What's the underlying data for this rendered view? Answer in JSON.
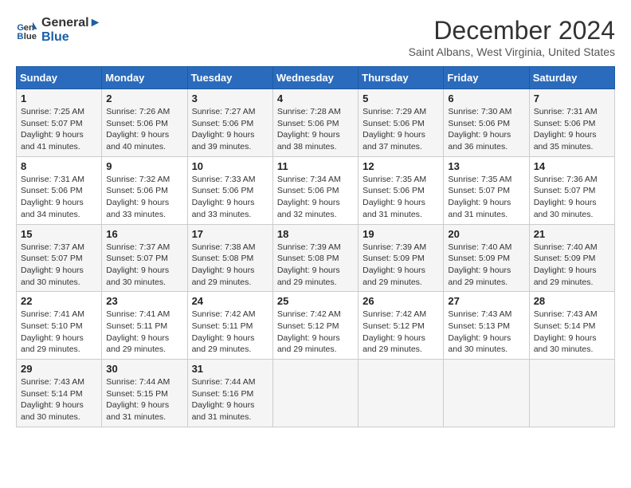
{
  "logo": {
    "line1": "General",
    "line2": "Blue"
  },
  "title": "December 2024",
  "subtitle": "Saint Albans, West Virginia, United States",
  "weekdays": [
    "Sunday",
    "Monday",
    "Tuesday",
    "Wednesday",
    "Thursday",
    "Friday",
    "Saturday"
  ],
  "weeks": [
    [
      {
        "day": "1",
        "sunrise": "7:25 AM",
        "sunset": "5:07 PM",
        "daylight": "9 hours and 41 minutes."
      },
      {
        "day": "2",
        "sunrise": "7:26 AM",
        "sunset": "5:06 PM",
        "daylight": "9 hours and 40 minutes."
      },
      {
        "day": "3",
        "sunrise": "7:27 AM",
        "sunset": "5:06 PM",
        "daylight": "9 hours and 39 minutes."
      },
      {
        "day": "4",
        "sunrise": "7:28 AM",
        "sunset": "5:06 PM",
        "daylight": "9 hours and 38 minutes."
      },
      {
        "day": "5",
        "sunrise": "7:29 AM",
        "sunset": "5:06 PM",
        "daylight": "9 hours and 37 minutes."
      },
      {
        "day": "6",
        "sunrise": "7:30 AM",
        "sunset": "5:06 PM",
        "daylight": "9 hours and 36 minutes."
      },
      {
        "day": "7",
        "sunrise": "7:31 AM",
        "sunset": "5:06 PM",
        "daylight": "9 hours and 35 minutes."
      }
    ],
    [
      {
        "day": "8",
        "sunrise": "7:31 AM",
        "sunset": "5:06 PM",
        "daylight": "9 hours and 34 minutes."
      },
      {
        "day": "9",
        "sunrise": "7:32 AM",
        "sunset": "5:06 PM",
        "daylight": "9 hours and 33 minutes."
      },
      {
        "day": "10",
        "sunrise": "7:33 AM",
        "sunset": "5:06 PM",
        "daylight": "9 hours and 33 minutes."
      },
      {
        "day": "11",
        "sunrise": "7:34 AM",
        "sunset": "5:06 PM",
        "daylight": "9 hours and 32 minutes."
      },
      {
        "day": "12",
        "sunrise": "7:35 AM",
        "sunset": "5:06 PM",
        "daylight": "9 hours and 31 minutes."
      },
      {
        "day": "13",
        "sunrise": "7:35 AM",
        "sunset": "5:07 PM",
        "daylight": "9 hours and 31 minutes."
      },
      {
        "day": "14",
        "sunrise": "7:36 AM",
        "sunset": "5:07 PM",
        "daylight": "9 hours and 30 minutes."
      }
    ],
    [
      {
        "day": "15",
        "sunrise": "7:37 AM",
        "sunset": "5:07 PM",
        "daylight": "9 hours and 30 minutes."
      },
      {
        "day": "16",
        "sunrise": "7:37 AM",
        "sunset": "5:07 PM",
        "daylight": "9 hours and 30 minutes."
      },
      {
        "day": "17",
        "sunrise": "7:38 AM",
        "sunset": "5:08 PM",
        "daylight": "9 hours and 29 minutes."
      },
      {
        "day": "18",
        "sunrise": "7:39 AM",
        "sunset": "5:08 PM",
        "daylight": "9 hours and 29 minutes."
      },
      {
        "day": "19",
        "sunrise": "7:39 AM",
        "sunset": "5:09 PM",
        "daylight": "9 hours and 29 minutes."
      },
      {
        "day": "20",
        "sunrise": "7:40 AM",
        "sunset": "5:09 PM",
        "daylight": "9 hours and 29 minutes."
      },
      {
        "day": "21",
        "sunrise": "7:40 AM",
        "sunset": "5:09 PM",
        "daylight": "9 hours and 29 minutes."
      }
    ],
    [
      {
        "day": "22",
        "sunrise": "7:41 AM",
        "sunset": "5:10 PM",
        "daylight": "9 hours and 29 minutes."
      },
      {
        "day": "23",
        "sunrise": "7:41 AM",
        "sunset": "5:11 PM",
        "daylight": "9 hours and 29 minutes."
      },
      {
        "day": "24",
        "sunrise": "7:42 AM",
        "sunset": "5:11 PM",
        "daylight": "9 hours and 29 minutes."
      },
      {
        "day": "25",
        "sunrise": "7:42 AM",
        "sunset": "5:12 PM",
        "daylight": "9 hours and 29 minutes."
      },
      {
        "day": "26",
        "sunrise": "7:42 AM",
        "sunset": "5:12 PM",
        "daylight": "9 hours and 29 minutes."
      },
      {
        "day": "27",
        "sunrise": "7:43 AM",
        "sunset": "5:13 PM",
        "daylight": "9 hours and 30 minutes."
      },
      {
        "day": "28",
        "sunrise": "7:43 AM",
        "sunset": "5:14 PM",
        "daylight": "9 hours and 30 minutes."
      }
    ],
    [
      {
        "day": "29",
        "sunrise": "7:43 AM",
        "sunset": "5:14 PM",
        "daylight": "9 hours and 30 minutes."
      },
      {
        "day": "30",
        "sunrise": "7:44 AM",
        "sunset": "5:15 PM",
        "daylight": "9 hours and 31 minutes."
      },
      {
        "day": "31",
        "sunrise": "7:44 AM",
        "sunset": "5:16 PM",
        "daylight": "9 hours and 31 minutes."
      },
      null,
      null,
      null,
      null
    ]
  ],
  "labels": {
    "sunrise": "Sunrise:",
    "sunset": "Sunset:",
    "daylight": "Daylight:"
  }
}
